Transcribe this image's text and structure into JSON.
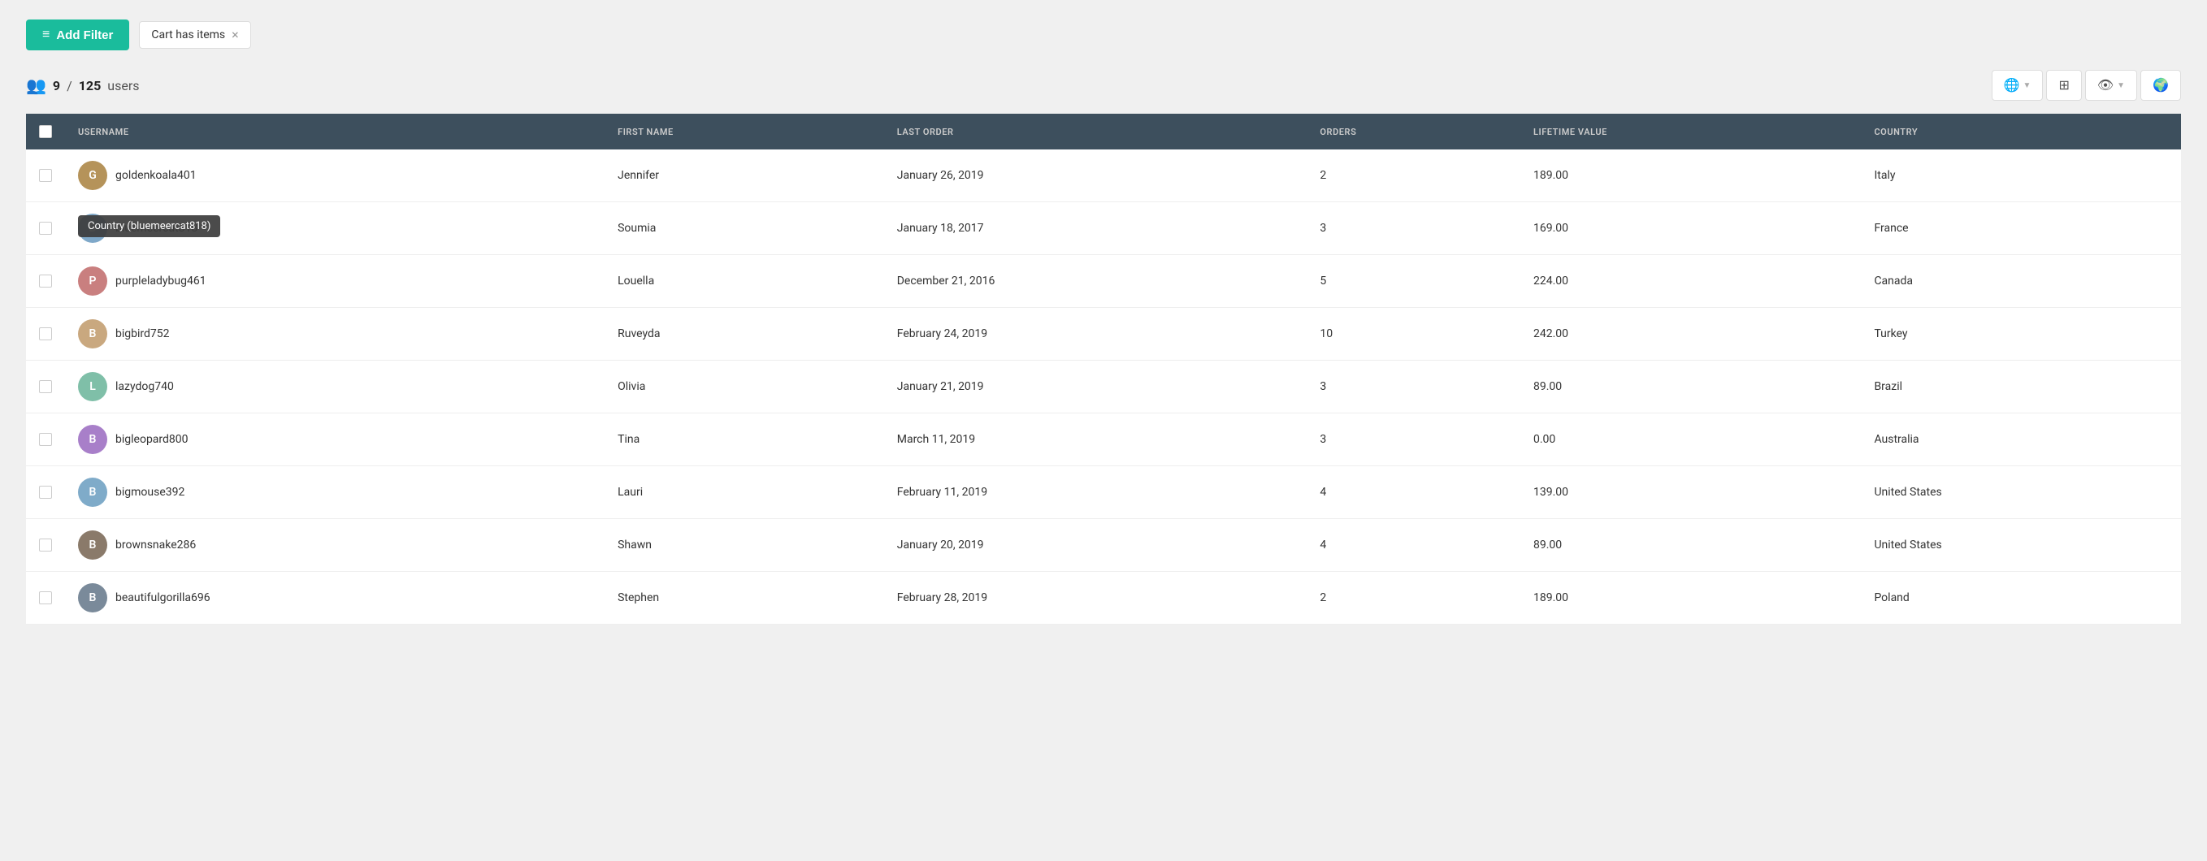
{
  "toolbar": {
    "add_filter_label": "Add Filter",
    "filter_tag_label": "Cart has items"
  },
  "stats": {
    "current": "9",
    "total": "125",
    "label": "users"
  },
  "table": {
    "columns": [
      {
        "key": "username",
        "label": "USERNAME"
      },
      {
        "key": "first_name",
        "label": "FIRST NAME"
      },
      {
        "key": "last_order",
        "label": "LAST ORDER"
      },
      {
        "key": "orders",
        "label": "ORDERS"
      },
      {
        "key": "lifetime_value",
        "label": "LIFETIME VALUE"
      },
      {
        "key": "country",
        "label": "COUNTRY"
      }
    ],
    "rows": [
      {
        "username": "goldenkoala401",
        "first_name": "Jennifer",
        "last_order": "January 26, 2019",
        "orders": "2",
        "lifetime_value": "189.00",
        "country": "Italy",
        "avatar_color": "#b5935a"
      },
      {
        "username": "bluemeercat818",
        "first_name": "Soumia",
        "last_order": "January 18, 2017",
        "orders": "3",
        "lifetime_value": "169.00",
        "country": "France",
        "avatar_color": "#7fa8c9",
        "tooltip": "Country (bluemeercat818)"
      },
      {
        "username": "purpleladybug461",
        "first_name": "Louella",
        "last_order": "December 21, 2016",
        "orders": "5",
        "lifetime_value": "224.00",
        "country": "Canada",
        "avatar_color": "#c97f7f"
      },
      {
        "username": "bigbird752",
        "first_name": "Ruveyda",
        "last_order": "February 24, 2019",
        "orders": "10",
        "lifetime_value": "242.00",
        "country": "Turkey",
        "avatar_color": "#c9a87f"
      },
      {
        "username": "lazydog740",
        "first_name": "Olivia",
        "last_order": "January 21, 2019",
        "orders": "3",
        "lifetime_value": "89.00",
        "country": "Brazil",
        "avatar_color": "#7fbfa8"
      },
      {
        "username": "bigleopard800",
        "first_name": "Tina",
        "last_order": "March 11, 2019",
        "orders": "3",
        "lifetime_value": "0.00",
        "country": "Australia",
        "avatar_color": "#a87fc9"
      },
      {
        "username": "bigmouse392",
        "first_name": "Lauri",
        "last_order": "February 11, 2019",
        "orders": "4",
        "lifetime_value": "139.00",
        "country": "United States",
        "avatar_color": "#7fabc9"
      },
      {
        "username": "brownsnake286",
        "first_name": "Shawn",
        "last_order": "January 20, 2019",
        "orders": "4",
        "lifetime_value": "89.00",
        "country": "United States",
        "avatar_color": "#8a7a6a"
      },
      {
        "username": "beautifulgorilla696",
        "first_name": "Stephen",
        "last_order": "February 28, 2019",
        "orders": "2",
        "lifetime_value": "189.00",
        "country": "Poland",
        "avatar_color": "#7a8a9a"
      }
    ]
  },
  "action_buttons": [
    {
      "label": "🌐",
      "has_chevron": true,
      "name": "globe-button"
    },
    {
      "label": "⊞",
      "has_chevron": false,
      "name": "grid-button"
    },
    {
      "label": "👁",
      "has_chevron": true,
      "name": "eye-button"
    },
    {
      "label": "🌍",
      "has_chevron": false,
      "name": "world-button"
    }
  ]
}
